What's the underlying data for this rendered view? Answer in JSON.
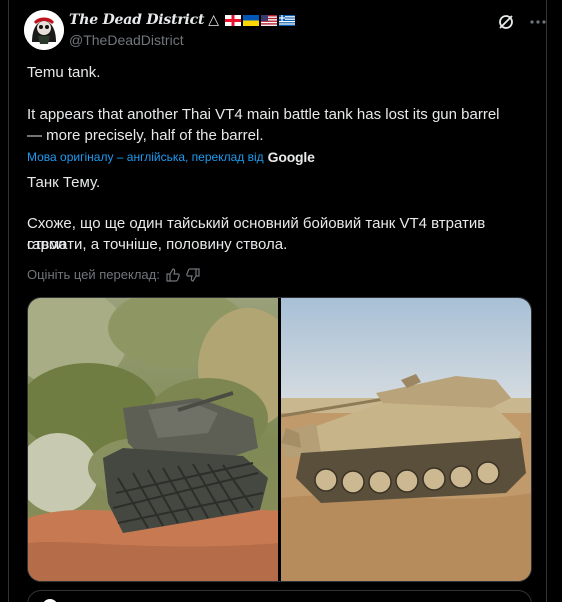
{
  "author": {
    "display_name": "The Dead District",
    "handle": "@TheDeadDistrict",
    "badge_symbol": "△",
    "flags": [
      "georgia-flag",
      "ukraine-flag",
      "usa-flag",
      "greece-flag"
    ]
  },
  "tweet": {
    "text_line_1": "Temu tank.",
    "text_line_2": "It appears that another Thai VT4 main battle tank has lost its gun barrel",
    "text_line_3": "— more precisely, half of the barrel.",
    "translated_by_label": "Мова оригіналу – англійська, переклад від",
    "translator": "Google",
    "translated_line_1": "Танк Тему.",
    "translated_line_2": "Схоже, що ще один тайський основний бойовий танк VT4 втратив ствол",
    "translated_line_3": "гармати, а точніше, половину ствола.",
    "rate_label": "Оцініть цей переклад:"
  },
  "icons": {
    "grok": "grok-icon",
    "more": "more-icon",
    "thumb_up": "thumb-up-icon",
    "thumb_down": "thumb-down-icon"
  },
  "colors": {
    "background": "#000000",
    "text": "#e7e9ea",
    "muted": "#71767b",
    "link": "#1d9bf0",
    "border": "#2f3336"
  }
}
